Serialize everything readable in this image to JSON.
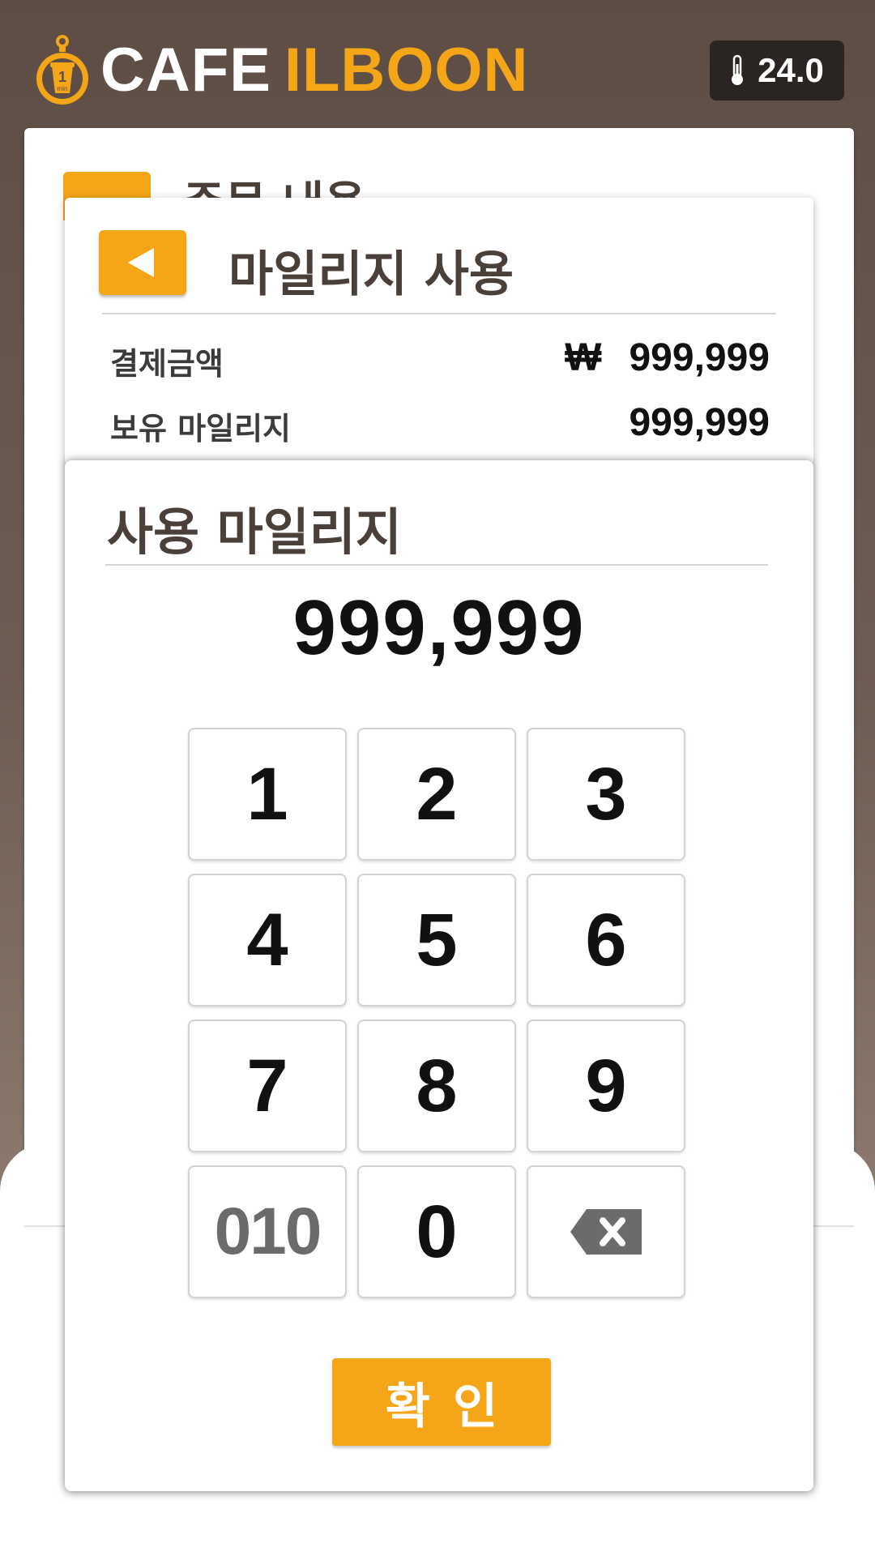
{
  "header": {
    "brand_word1": "CAFE",
    "brand_word2": "ILBOON",
    "logo_icon_text": "1",
    "logo_icon_subtext": "min",
    "temperature": "24.0"
  },
  "background_screen": {
    "title": "주문 내용"
  },
  "mileage_panel": {
    "title": "마일리지 사용",
    "rows": [
      {
        "label": "결제금액",
        "currency": "₩",
        "value": "999,999"
      },
      {
        "label": "보유 마일리지",
        "value": "999,999"
      }
    ]
  },
  "use_panel": {
    "title": "사용 마일리지",
    "amount": "999,999",
    "keys": [
      "1",
      "2",
      "3",
      "4",
      "5",
      "6",
      "7",
      "8",
      "9",
      "010",
      "0",
      "backspace"
    ],
    "confirm_label": "확인"
  },
  "colors": {
    "accent": "#f5a518",
    "header_bg": "#5d4d45",
    "text_dark": "#4a3f39"
  }
}
